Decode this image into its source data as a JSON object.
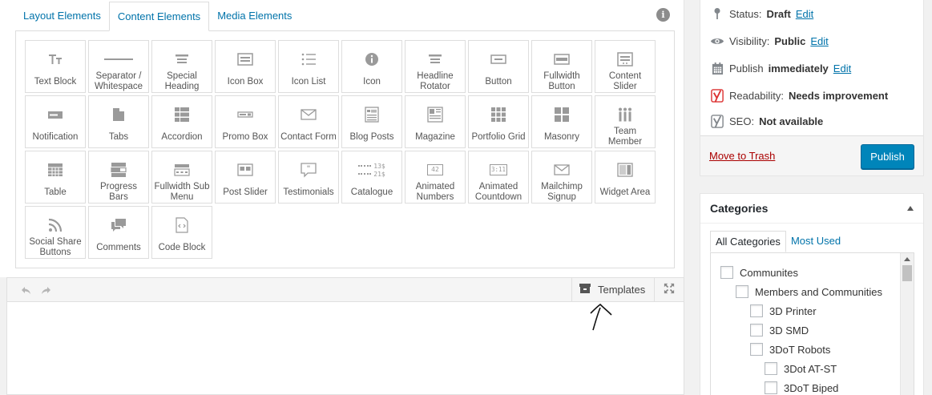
{
  "tabs": [
    {
      "label": "Layout Elements",
      "active": false
    },
    {
      "label": "Content Elements",
      "active": true
    },
    {
      "label": "Media Elements",
      "active": false
    }
  ],
  "info_icon": "info-icon",
  "elements": [
    {
      "label": "Text Block",
      "icon": "text-block-icon"
    },
    {
      "label": "Separator / Whitespace",
      "icon": "separator-icon"
    },
    {
      "label": "Special Heading",
      "icon": "heading-icon"
    },
    {
      "label": "Icon Box",
      "icon": "icon-box-icon"
    },
    {
      "label": "Icon List",
      "icon": "icon-list-icon"
    },
    {
      "label": "Icon",
      "icon": "info-circle-icon"
    },
    {
      "label": "Headline Rotator",
      "icon": "headline-icon"
    },
    {
      "label": "Button",
      "icon": "button-icon"
    },
    {
      "label": "Fullwidth Button",
      "icon": "fullwidth-button-icon"
    },
    {
      "label": "Content Slider",
      "icon": "content-slider-icon"
    },
    {
      "label": "Notification",
      "icon": "notification-icon"
    },
    {
      "label": "Tabs",
      "icon": "tabs-icon"
    },
    {
      "label": "Accordion",
      "icon": "accordion-icon"
    },
    {
      "label": "Promo Box",
      "icon": "promo-box-icon"
    },
    {
      "label": "Contact Form",
      "icon": "envelope-icon"
    },
    {
      "label": "Blog Posts",
      "icon": "blog-posts-icon"
    },
    {
      "label": "Magazine",
      "icon": "magazine-icon"
    },
    {
      "label": "Portfolio Grid",
      "icon": "grid-icon"
    },
    {
      "label": "Masonry",
      "icon": "masonry-icon"
    },
    {
      "label": "Team Member",
      "icon": "team-icon"
    },
    {
      "label": "Table",
      "icon": "table-icon"
    },
    {
      "label": "Progress Bars",
      "icon": "progress-bars-icon"
    },
    {
      "label": "Fullwidth Sub Menu",
      "icon": "sub-menu-icon"
    },
    {
      "label": "Post Slider",
      "icon": "post-slider-icon"
    },
    {
      "label": "Testimonials",
      "icon": "quote-icon"
    },
    {
      "label": "Catalogue",
      "icon": "catalogue-icon"
    },
    {
      "label": "Animated Numbers",
      "icon": "animated-numbers-icon"
    },
    {
      "label": "Animated Countdown",
      "icon": "countdown-icon"
    },
    {
      "label": "Mailchimp Signup",
      "icon": "mail-icon"
    },
    {
      "label": "Widget Area",
      "icon": "widget-area-icon"
    },
    {
      "label": "Social Share Buttons",
      "icon": "rss-icon"
    },
    {
      "label": "Comments",
      "icon": "comments-icon"
    },
    {
      "label": "Code Block",
      "icon": "code-icon"
    }
  ],
  "catalogue_prices": [
    "13$",
    "21$"
  ],
  "animated_numbers_value": "42",
  "countdown_value": "3:11",
  "editor": {
    "templates_label": "Templates"
  },
  "publish": {
    "status_label": "Status:",
    "status_value": "Draft",
    "visibility_label": "Visibility:",
    "visibility_value": "Public",
    "publish_label": "Publish",
    "publish_value": "immediately",
    "readability_label": "Readability:",
    "readability_value": "Needs improvement",
    "seo_label": "SEO:",
    "seo_value": "Not available",
    "edit_label": "Edit",
    "trash_label": "Move to Trash",
    "publish_button": "Publish"
  },
  "categories": {
    "title": "Categories",
    "tab_all": "All Categories",
    "tab_used": "Most Used",
    "items": [
      {
        "label": "Communites",
        "level": 0
      },
      {
        "label": "Members and Communities",
        "level": 1
      },
      {
        "label": "3D Printer",
        "level": 2
      },
      {
        "label": "3D SMD",
        "level": 2
      },
      {
        "label": "3DoT Robots",
        "level": 2
      },
      {
        "label": "3Dot AT-ST",
        "level": 3
      },
      {
        "label": "3DoT Biped",
        "level": 3
      }
    ]
  },
  "colors": {
    "link": "#0073aa",
    "publish_button": "#0085ba",
    "trash": "#aa0000",
    "yoast_red": "#dc3232"
  }
}
